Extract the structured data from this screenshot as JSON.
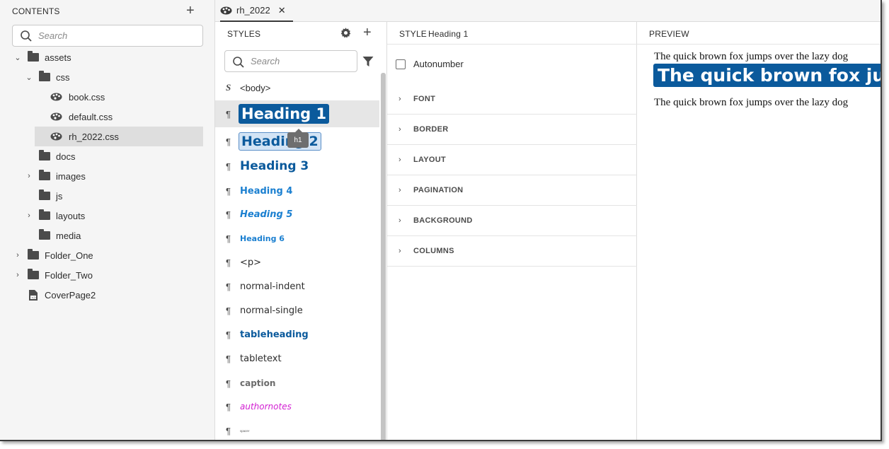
{
  "contents": {
    "title": "CONTENTS",
    "add_icon": "+",
    "search_placeholder": "Search",
    "tree": [
      {
        "label": "assets",
        "expanded": true
      },
      {
        "label": "css",
        "expanded": true
      },
      {
        "label": "book.css"
      },
      {
        "label": "default.css"
      },
      {
        "label": "rh_2022.css",
        "selected": true
      },
      {
        "label": "docs"
      },
      {
        "label": "images",
        "expanded": false
      },
      {
        "label": "js"
      },
      {
        "label": "layouts",
        "expanded": false
      },
      {
        "label": "media"
      },
      {
        "label": "Folder_One",
        "expanded": false
      },
      {
        "label": "Folder_Two",
        "expanded": false
      },
      {
        "label": "CoverPage2"
      }
    ]
  },
  "tab": {
    "label": "rh_2022",
    "close": "✕"
  },
  "styles": {
    "title": "STYLES",
    "search_placeholder": "Search",
    "body_glyph": "S",
    "tooltip": "h1",
    "items": [
      {
        "label": "<body>"
      },
      {
        "label": "Heading 1",
        "selected": true
      },
      {
        "label": "Heading 2"
      },
      {
        "label": "Heading 3"
      },
      {
        "label": "Heading 4"
      },
      {
        "label": "Heading 5"
      },
      {
        "label": "Heading 6"
      },
      {
        "label": "<p>"
      },
      {
        "label": "normal-indent"
      },
      {
        "label": "normal-single"
      },
      {
        "label": "tableheading"
      },
      {
        "label": "tabletext"
      },
      {
        "label": "caption"
      },
      {
        "label": "authornotes"
      },
      {
        "label": "spacer"
      }
    ],
    "pilcrow": "¶"
  },
  "editor": {
    "label": "STYLE",
    "style_name": "Heading 1",
    "autonumber": "Autonumber",
    "autonumber_checked": false,
    "sections": [
      "FONT",
      "BORDER",
      "LAYOUT",
      "PAGINATION",
      "BACKGROUND",
      "COLUMNS"
    ]
  },
  "preview": {
    "title": "PREVIEW",
    "line1": "The quick brown fox jumps over the lazy dog",
    "heading": "The quick brown fox jumps over the lazy dog",
    "line2": "The quick brown fox jumps over the lazy dog"
  },
  "colors": {
    "heading_blue": "#0b5a9c",
    "heading_light_blue": "#1a7fd0",
    "authornotes_magenta": "#d21fd2",
    "caption_gray": "#6b6b6b"
  }
}
